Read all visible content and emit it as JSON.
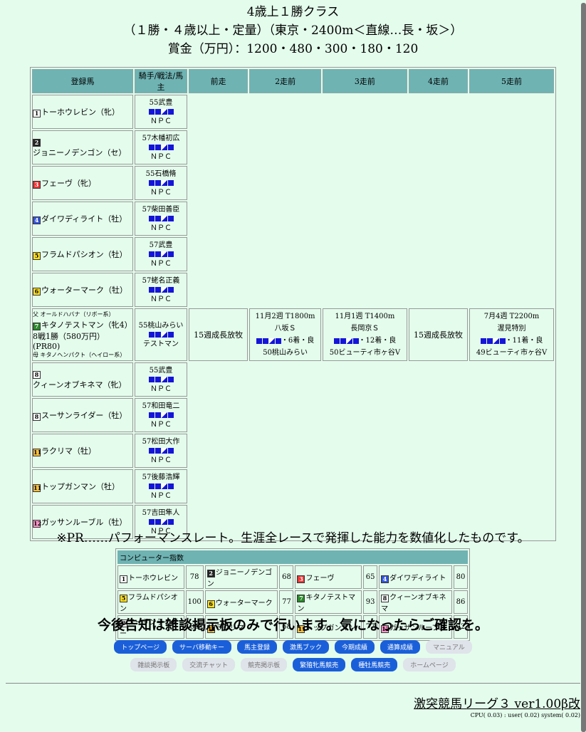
{
  "race": {
    "title": "4歳上１勝クラス",
    "conditions": "（１勝・４歳以上・定量）（東京・2400m＜直線…長・坂＞）",
    "prize": "賞金（万円）：1200・480・300・180・120"
  },
  "columns": [
    "登録馬",
    "騎手/戦法/馬主",
    "前走",
    "2走前",
    "3走前",
    "4走前",
    "5走前"
  ],
  "horses": [
    {
      "waku": "1",
      "name": "トーホウレビン（牝）",
      "jockey": "55武豊",
      "owner": "ＮＰＣ"
    },
    {
      "waku": "2",
      "name": "ジョニーノデンゴン（セ）",
      "jockey": "57木幡初広",
      "owner": "ＮＰＣ"
    },
    {
      "waku": "3",
      "name": "フェーヴ（牝）",
      "jockey": "55石橋脩",
      "owner": "ＮＰＣ"
    },
    {
      "waku": "4",
      "name": "ダイワディライト（牡）",
      "jockey": "57柴田善臣",
      "owner": "ＮＰＣ"
    },
    {
      "waku": "5",
      "name": "フラムドパシオン（牡）",
      "jockey": "57武豊",
      "owner": "ＮＰＣ"
    },
    {
      "waku": "6",
      "name": "ウォーターマーク（牡）",
      "jockey": "57蛯名正義",
      "owner": "ＮＰＣ"
    },
    {
      "waku": "8",
      "name": "クィーンオブキネマ（牝）",
      "jockey": "55武豊",
      "owner": "ＮＰＣ"
    },
    {
      "waku": "8",
      "name": "スーサンライダー（牡）",
      "jockey": "57和田竜二",
      "owner": "ＮＰＣ"
    },
    {
      "waku": "11",
      "name": "ラクリマ（牡）",
      "jockey": "57松田大作",
      "owner": "ＮＰＣ"
    },
    {
      "waku": "11",
      "name": "トップガンマン（牡）",
      "jockey": "57後藤浩輝",
      "owner": "ＮＰＣ"
    },
    {
      "waku": "12",
      "name": "ガッサンルーブル（牡）",
      "jockey": "57吉田隼人",
      "owner": "ＮＰＣ"
    }
  ],
  "featured": {
    "sire": "父 オールドハバナ（リボー系）",
    "waku": "7",
    "name": "キタノテストマン（牝4）",
    "record": "8戦1勝（580万円）　(PR80)",
    "dam": "母 キタノヘンパクト（ヘイロー系）",
    "jockey": "55桃山みらい",
    "owner": "テストマン",
    "r1": "15週成長放牧",
    "r2": {
      "date": "11月2週 T1800m",
      "race": "八坂Ｓ",
      "result": "・6着・良",
      "jockey": "50桃山みらい"
    },
    "r3": {
      "date": "11月1週 T1400m",
      "race": "長岡京Ｓ",
      "result": "・12着・良",
      "jockey": "50ビューティ市ヶ谷V"
    },
    "r4": "15週成長放牧",
    "r5": {
      "date": "7月4週 T2200m",
      "race": "渥見特別",
      "result": "・11着・良",
      "jockey": "49ビューティ市ヶ谷V"
    }
  },
  "pr_note": "※PR……パフォーマンスレート。生涯全レースで発揮した能力を数値化したものです。",
  "ci": {
    "title": "コンピューター指数",
    "rows": [
      [
        {
          "w": "1",
          "n": "トーホウレビン",
          "s": "78"
        },
        {
          "w": "2",
          "n": "ジョニーノデンゴン",
          "s": "68"
        },
        {
          "w": "3",
          "n": "フェーヴ",
          "s": "65"
        },
        {
          "w": "4",
          "n": "ダイワディライト",
          "s": "80"
        }
      ],
      [
        {
          "w": "5",
          "n": "フラムドパシオン",
          "s": "100"
        },
        {
          "w": "6",
          "n": "ウォーターマーク",
          "s": "77"
        },
        {
          "w": "7",
          "n": "キタノテストマン",
          "s": "93"
        },
        {
          "w": "8",
          "n": "クィーンオブキネマ",
          "s": "86"
        }
      ],
      [
        {
          "w": "8",
          "n": "スーサンライダー",
          "s": "80"
        },
        {
          "w": "11",
          "n": "ラクリマ",
          "s": "68"
        },
        {
          "w": "11",
          "n": "トップガンマン",
          "s": "77"
        },
        {
          "w": "12",
          "n": "ガッサンルーブル",
          "s": "72"
        }
      ]
    ]
  },
  "notice": "今後告知は雑談掲示板のみで行います。気になったらご確認を。",
  "nav1": [
    {
      "l": "トップページ",
      "on": true
    },
    {
      "l": "サーバ移動キー",
      "on": true
    },
    {
      "l": "馬主登録",
      "on": true
    },
    {
      "l": "激馬ブック",
      "on": true
    },
    {
      "l": "今期成績",
      "on": true
    },
    {
      "l": "通算成績",
      "on": true
    },
    {
      "l": "マニュアル",
      "on": false
    }
  ],
  "nav2": [
    {
      "l": "雑談掲示板",
      "on": false
    },
    {
      "l": "交流チャット",
      "on": false
    },
    {
      "l": "競売掲示板",
      "on": false
    },
    {
      "l": "繁殖牝馬競売",
      "on": true
    },
    {
      "l": "種牡馬競売",
      "on": true
    },
    {
      "l": "ホームページ",
      "on": false
    }
  ],
  "footer": "激突競馬リーグ３ ver1.00β改",
  "cpu": "CPU( 0.03) : user( 0.02) system( 0.02)",
  "waku_colors": {
    "1": "#ffffff",
    "2": "#222222",
    "3": "#e33",
    "4": "#3355dd",
    "5": "#ffe020",
    "6": "#ffe020",
    "7": "#2a8a2a",
    "8": "#ffffff",
    "11": "#f7c040",
    "12": "#ff99cc"
  }
}
